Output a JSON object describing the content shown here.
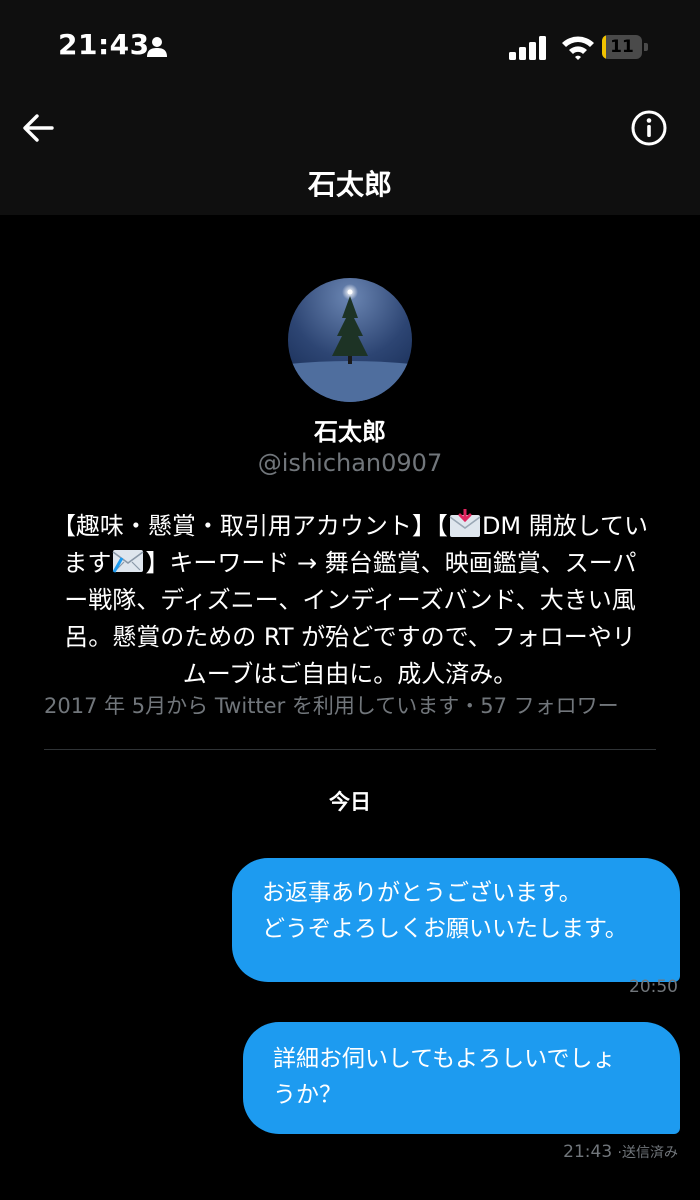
{
  "status_bar": {
    "time": "21:43",
    "battery": {
      "level_text": "11",
      "level_fraction": 0.11,
      "color": "#f2c200"
    }
  },
  "header": {
    "title": "石太郎",
    "back_icon": "arrow-left-icon",
    "info_icon": "info-circle-icon"
  },
  "profile": {
    "name": "石太郎",
    "handle": "@ishichan0907",
    "bio_lines": {
      "l1_a": "【趣味・懸賞・取引用アカウント】【",
      "l1_b": "DM 開放してい",
      "l2_a": "ます",
      "l2_b": "】キーワード → 舞台鑑賞、映画鑑賞、スーパ",
      "l3": "ー戦隊、ディズニー、インディーズバンド、大きい風",
      "l4": "呂。懸賞のための RT が殆どですので、フォローやリ",
      "l5": "ムーブはご自由に。成人済み。"
    },
    "meta": "2017 年 5月から Twitter を利用しています・57 フォロワー"
  },
  "conversation": {
    "date_label": "今日",
    "messages": [
      {
        "lines": [
          "お返事ありがとうございます。",
          "どうぞよろしくお願いいたします。"
        ],
        "time": "20:50",
        "status": ""
      },
      {
        "lines": [
          "詳細お伺いしてもよろしいでしょ",
          "うか？"
        ],
        "time": "21:43",
        "status": "·送信済み"
      }
    ]
  },
  "colors": {
    "accent": "#1d9bf0",
    "background": "#000000",
    "secondary_text": "#71767b"
  }
}
